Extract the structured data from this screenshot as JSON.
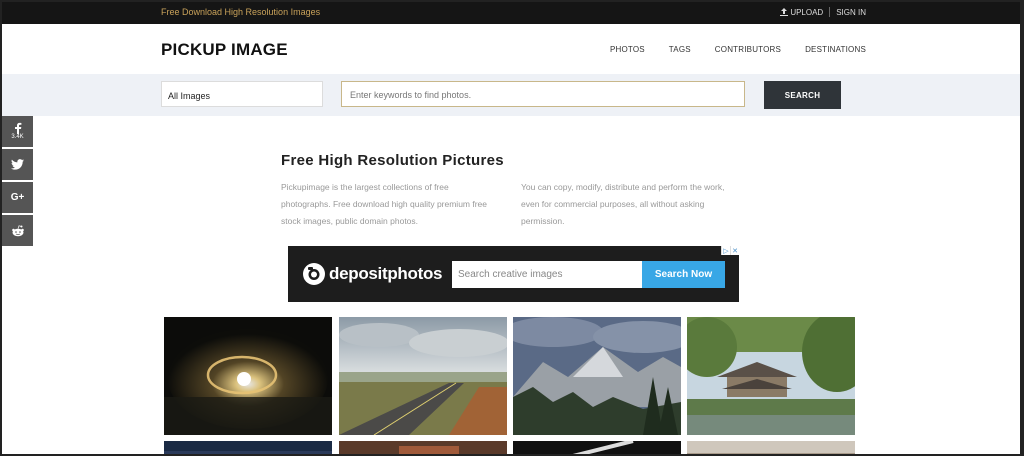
{
  "topbar": {
    "promo": "Free Download High Resolution Images",
    "upload": "UPLOAD",
    "signin": "SIGN IN"
  },
  "header": {
    "logo": "PICKUP IMAGE",
    "nav": [
      "PHOTOS",
      "TAGS",
      "CONTRIBUTORS",
      "DESTINATIONS"
    ]
  },
  "search": {
    "category": "All Images",
    "placeholder": "Enter keywords to find photos.",
    "button": "SEARCH"
  },
  "social": {
    "facebook_count": "3.4K",
    "icons": [
      "facebook-icon",
      "twitter-icon",
      "google-plus-icon",
      "reddit-icon"
    ]
  },
  "intro": {
    "title": "Free High Resolution Pictures",
    "col1": "Pickupimage is the largest collections of free photographs. Free download high quality premium free stock images, public domain photos.",
    "col2": "You can copy, modify, distribute and perform the work, even for commercial purposes, all without asking permission."
  },
  "ad": {
    "brand": "depositphotos",
    "input_value": "Search creative images",
    "button": "Search Now"
  },
  "colors": {
    "topbar_bg": "#151515",
    "promo_text": "#c9a25a",
    "search_bg": "#eef1f6",
    "search_button": "#2f3439",
    "social_bg": "#555555",
    "ad_button": "#38a7e6"
  }
}
